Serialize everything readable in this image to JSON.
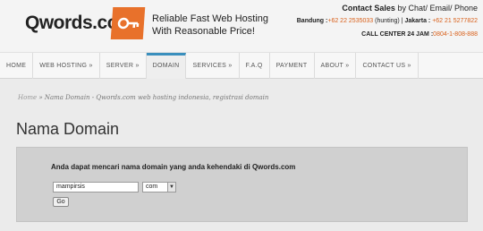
{
  "brand": {
    "name": "Qwords.com",
    "tagline_line1": "Reliable Fast Web Hosting",
    "tagline_line2": "With Reasonable Price!"
  },
  "contact": {
    "title_bold": "Contact Sales",
    "title_rest": " by Chat/ Email/ Phone",
    "bandung_label": "Bandung :",
    "bandung_number": "+62 22 2535033",
    "bandung_note": " (hunting) | ",
    "jakarta_label": "Jakarta :",
    "jakarta_number": " +62 21 5277822",
    "callcenter_label": "CALL CENTER 24 JAM :",
    "callcenter_number": "0804-1-808-888"
  },
  "nav": {
    "items": [
      {
        "label": "HOME",
        "active": false
      },
      {
        "label": "WEB HOSTING »",
        "active": false
      },
      {
        "label": "SERVER »",
        "active": false
      },
      {
        "label": "DOMAIN",
        "active": true
      },
      {
        "label": "SERVICES »",
        "active": false
      },
      {
        "label": "F.A.Q",
        "active": false
      },
      {
        "label": "PAYMENT",
        "active": false
      },
      {
        "label": "ABOUT »",
        "active": false
      },
      {
        "label": "CONTACT US »",
        "active": false
      }
    ]
  },
  "breadcrumb": {
    "home": "Home",
    "separator": " » ",
    "current": "Nama Domain - Qwords.com web hosting indonesia, registrasi domain"
  },
  "page": {
    "title": "Nama Domain"
  },
  "domain_search": {
    "description": "Anda dapat mencari nama domain yang anda kehendaki di Qwords.com",
    "input_value": "mampirsis",
    "tld_selected": "com",
    "submit_label": "Go"
  },
  "colors": {
    "accent": "#e8712b",
    "nav_active": "#3a8fbd"
  }
}
